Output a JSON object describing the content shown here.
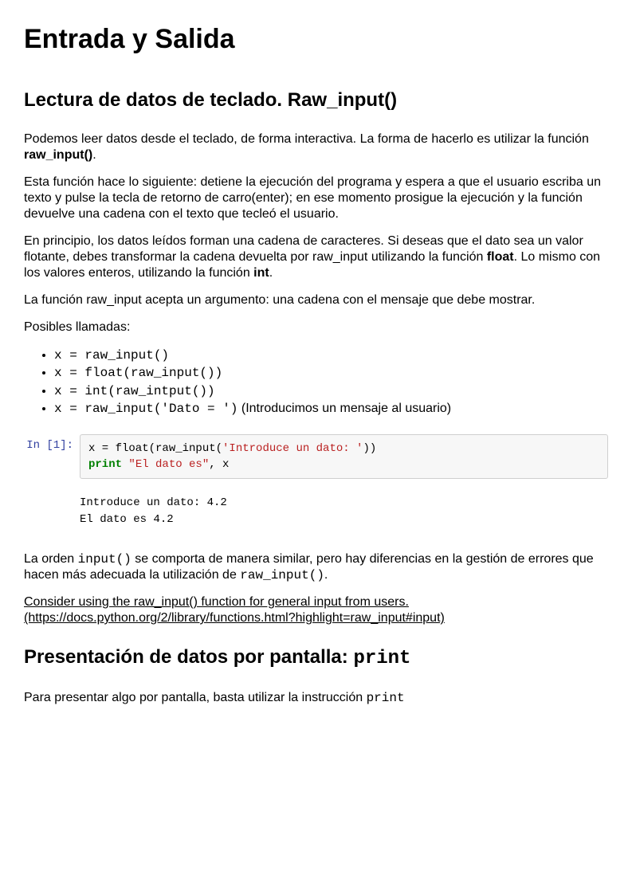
{
  "title": "Entrada y Salida",
  "section1": {
    "heading": "Lectura de datos de teclado. Raw_input()",
    "p1a": "Podemos leer datos desde el teclado, de forma interactiva. La forma de hacerlo es utilizar la función ",
    "p1b": "raw_input()",
    "p1c": ".",
    "p2": "Esta función hace lo siguiente: detiene la ejecución del programa y espera a que el usuario escriba un texto y pulse la tecla de retorno de carro(enter); en ese momento prosigue la ejecución y la función devuelve una cadena con el texto que tecleó el usuario.",
    "p3a": "En principio, los datos leídos forman una cadena de caracteres. Si deseas que el dato sea un valor flotante, debes transformar la cadena devuelta por raw_input utilizando la función ",
    "p3b": "float",
    "p3c": ". Lo mismo con los valores enteros, utilizando la función ",
    "p3d": "int",
    "p3e": ".",
    "p4": "La función raw_input acepta un argumento: una cadena con el mensaje que debe mostrar.",
    "p5": "Posibles llamadas:",
    "li1": "x = raw_input()",
    "li2": "x = float(raw_input())",
    "li3": "x = int(raw_intput())",
    "li4code": "x = raw_input('Dato = ')",
    "li4rest": " (Introducimos un mensaje al usuario)",
    "prompt": "In [1]:",
    "code_line1a": "x = float(raw_input(",
    "code_line1b": "'Introduce un dato: '",
    "code_line1c": "))",
    "code_line2kw": "print",
    "code_line2a": " ",
    "code_line2str": "\"El dato es\"",
    "code_line2b": ", x",
    "output": "Introduce un dato: 4.2\nEl dato es 4.2",
    "p6a": "La orden ",
    "p6b": "input()",
    "p6c": " se comporta de manera similar, pero hay diferencias en la gestión de errores que hacen más adecuada la utilización de ",
    "p6d": "raw_input()",
    "p6e": ".",
    "link": "Consider using the raw_input() function for general input from users. (https://docs.python.org/2/library/functions.html?highlight=raw_input#input)"
  },
  "section2": {
    "heading_a": "Presentación de datos por pantalla: ",
    "heading_b": "print",
    "p1a": "Para presentar algo por pantalla, basta utilizar la instrucción ",
    "p1b": "print"
  }
}
